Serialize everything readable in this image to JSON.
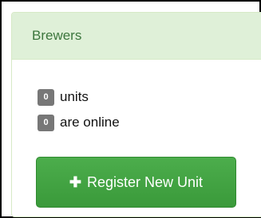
{
  "panel": {
    "title": "Brewers"
  },
  "stats": {
    "units_count": "0",
    "units_label": "units",
    "online_count": "0",
    "online_label": "are online"
  },
  "register_button": {
    "icon": "plus-icon",
    "label": "Register New Unit"
  },
  "colors": {
    "heading_bg": "#dff0d8",
    "heading_text": "#3c763d",
    "badge_bg": "#777777",
    "button_bg": "#449d44"
  }
}
